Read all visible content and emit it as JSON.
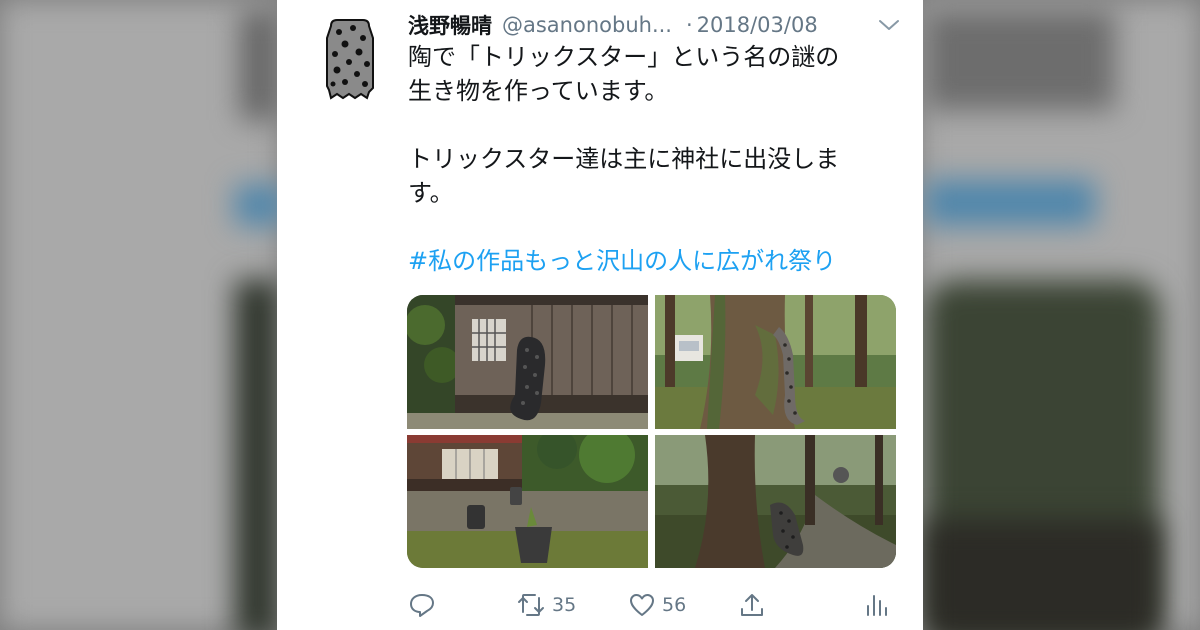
{
  "tweet": {
    "display_name": "浅野暢晴",
    "handle": "@asanonobuh...",
    "date_separator": "·",
    "date": "2018/03/08",
    "text_line1": "陶で「トリックスター」という名の謎の",
    "text_line2": "生き物を作っています。",
    "text_line3": "トリックスター達は主に神社に出没しま",
    "text_line4": "す。",
    "hashtag": "#私の作品もっと沢山の人に広がれ祭り"
  },
  "icons": {
    "avatar": "spotted-creature-avatar",
    "menu": "chevron-down-icon",
    "reply": "reply-icon",
    "retweet": "retweet-icon",
    "like": "heart-icon",
    "share": "share-icon",
    "analytics": "analytics-icon"
  },
  "photos": [
    {
      "label": "shrine-wall-creature"
    },
    {
      "label": "tree-trunk-creature"
    },
    {
      "label": "shrine-yard-pots"
    },
    {
      "label": "forest-path-creature"
    }
  ],
  "actions": {
    "retweet_count": "35",
    "like_count": "56"
  },
  "colors": {
    "link": "#1da1f2",
    "secondary_text": "#657786",
    "primary_text": "#14171a"
  }
}
